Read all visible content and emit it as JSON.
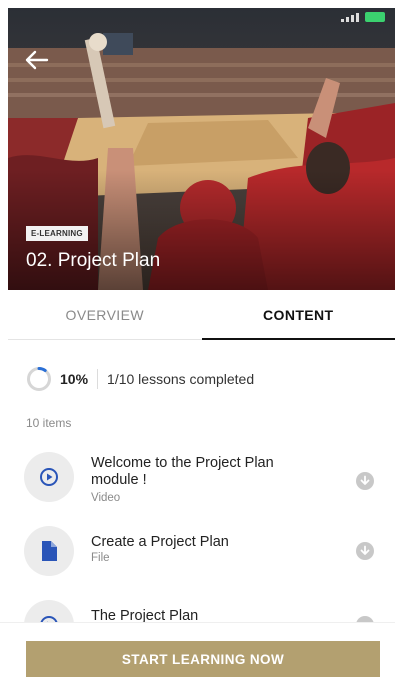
{
  "hero": {
    "badge": "E-LEARNING",
    "title": "02. Project Plan"
  },
  "tabs": [
    {
      "label": "OVERVIEW",
      "active": false
    },
    {
      "label": "CONTENT",
      "active": true
    }
  ],
  "progress": {
    "percent": 10,
    "percent_label": "10%",
    "lessons_label": "1/10 lessons completed"
  },
  "items_count": "10 items",
  "items": [
    {
      "title": "Welcome to the Project Plan module !",
      "type": "Video",
      "icon": "play-icon"
    },
    {
      "title": "Create a Project Plan",
      "type": "File",
      "icon": "file-icon"
    },
    {
      "title": "The Project Plan",
      "type": "",
      "icon": "play-icon"
    }
  ],
  "cta": {
    "label": "START LEARNING NOW"
  },
  "colors": {
    "accent": "#b3a070",
    "icon_blue": "#2a55b8",
    "ring_blue": "#2a6fd6"
  }
}
